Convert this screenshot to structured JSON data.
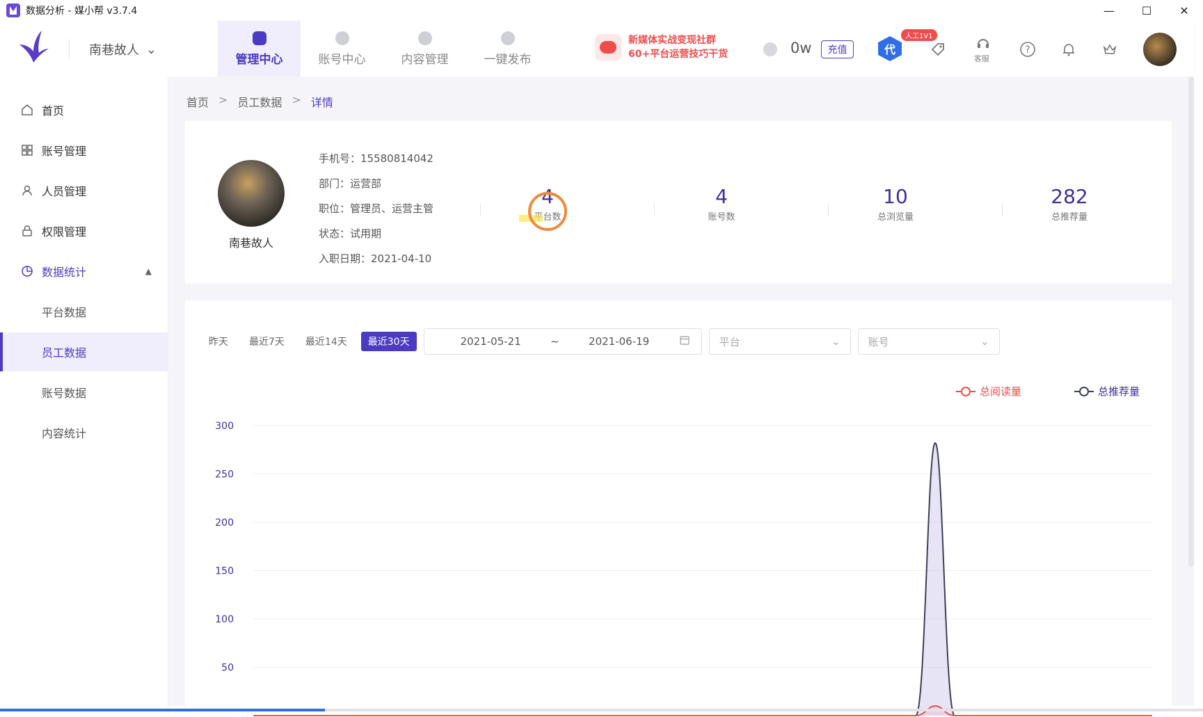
{
  "window": {
    "title": "数据分析 - 媒小帮 v3.7.4"
  },
  "header": {
    "user_name": "南巷故人",
    "nav": [
      {
        "label": "管理中心",
        "active": true,
        "icon": "briefcase-icon"
      },
      {
        "label": "账号中心",
        "active": false,
        "icon": "account-icon"
      },
      {
        "label": "内容管理",
        "active": false,
        "icon": "content-icon"
      },
      {
        "label": "一键发布",
        "active": false,
        "icon": "publish-icon"
      }
    ],
    "promo_line1": "新媒体实战变现社群",
    "promo_line2": "60+平台运营技巧干货",
    "balance": "0w",
    "recharge_label": "充值",
    "dai_label": "代",
    "badge_1v1": "人工1V1",
    "kefu_label": "客服"
  },
  "sidebar": {
    "items": [
      {
        "label": "首页",
        "icon": "home-icon"
      },
      {
        "label": "账号管理",
        "icon": "grid-icon"
      },
      {
        "label": "人员管理",
        "icon": "user-icon"
      },
      {
        "label": "权限管理",
        "icon": "lock-icon"
      },
      {
        "label": "数据统计",
        "icon": "pie-chart-icon"
      },
      {
        "label": "平台数据"
      },
      {
        "label": "员工数据",
        "active": true
      },
      {
        "label": "账号数据"
      },
      {
        "label": "内容统计"
      }
    ]
  },
  "breadcrumb": [
    "首页",
    "员工数据",
    "详情"
  ],
  "profile": {
    "name": "南巷故人",
    "phone": "手机号：15580814042",
    "department": "部门：运营部",
    "position": "职位：管理员、运营主管",
    "status": "状态：试用期",
    "join_date": "入职日期：2021-04-10",
    "stats": [
      {
        "value": "4",
        "label": "平台数"
      },
      {
        "value": "4",
        "label": "账号数"
      },
      {
        "value": "10",
        "label": "总浏览量"
      },
      {
        "value": "282",
        "label": "总推荐量"
      }
    ]
  },
  "filters": {
    "quick": [
      "昨天",
      "最近7天",
      "最近14天",
      "最近30天"
    ],
    "active_quick": "最近30天",
    "date_start": "2021-05-21",
    "date_sep": "~",
    "date_end": "2021-06-19",
    "platform_placeholder": "平台",
    "account_placeholder": "账号"
  },
  "chart_data": {
    "type": "area",
    "series": [
      {
        "name": "总阅读量",
        "color": "#f04c4c",
        "values": [
          0,
          0,
          0,
          0,
          0,
          0,
          0,
          0,
          0,
          0,
          0,
          0,
          0,
          0,
          0,
          0,
          0,
          0,
          0,
          0,
          0,
          0,
          10,
          0,
          0,
          0,
          0,
          0,
          0,
          0
        ]
      },
      {
        "name": "总推荐量",
        "color": "#3b3f58",
        "values": [
          0,
          0,
          0,
          0,
          0,
          0,
          0,
          0,
          0,
          0,
          0,
          0,
          0,
          0,
          0,
          0,
          0,
          0,
          0,
          0,
          0,
          0,
          282,
          0,
          0,
          0,
          0,
          0,
          0,
          0
        ]
      }
    ],
    "yticks": [
      50,
      100,
      150,
      200,
      250,
      300
    ],
    "ylim": [
      0,
      300
    ],
    "grid": true,
    "legend_position": "top-right"
  },
  "progress": {
    "fraction": 0.27
  }
}
